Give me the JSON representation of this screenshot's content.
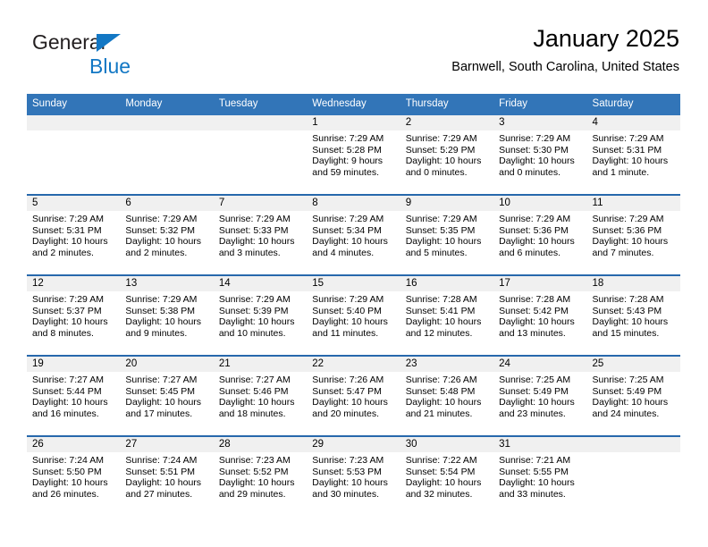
{
  "brand": {
    "line1": "General",
    "line2": "Blue",
    "accent_color": "#1277c4"
  },
  "header": {
    "title": "January 2025",
    "location": "Barnwell, South Carolina, United States"
  },
  "theme": {
    "header_bg": "#3275b8",
    "row_divider": "#2768ac",
    "daynum_band_bg": "#f0f0f0",
    "page_bg": "#ffffff"
  },
  "weekday_headers": [
    "Sunday",
    "Monday",
    "Tuesday",
    "Wednesday",
    "Thursday",
    "Friday",
    "Saturday"
  ],
  "calendar": {
    "weeks": [
      [
        {
          "day": "",
          "blank": true,
          "sunrise": "",
          "sunset": "",
          "daylight1": "",
          "daylight2": ""
        },
        {
          "day": "",
          "blank": true,
          "sunrise": "",
          "sunset": "",
          "daylight1": "",
          "daylight2": ""
        },
        {
          "day": "",
          "blank": true,
          "sunrise": "",
          "sunset": "",
          "daylight1": "",
          "daylight2": ""
        },
        {
          "day": "1",
          "blank": false,
          "sunrise": "Sunrise: 7:29 AM",
          "sunset": "Sunset: 5:28 PM",
          "daylight1": "Daylight: 9 hours",
          "daylight2": "and 59 minutes."
        },
        {
          "day": "2",
          "blank": false,
          "sunrise": "Sunrise: 7:29 AM",
          "sunset": "Sunset: 5:29 PM",
          "daylight1": "Daylight: 10 hours",
          "daylight2": "and 0 minutes."
        },
        {
          "day": "3",
          "blank": false,
          "sunrise": "Sunrise: 7:29 AM",
          "sunset": "Sunset: 5:30 PM",
          "daylight1": "Daylight: 10 hours",
          "daylight2": "and 0 minutes."
        },
        {
          "day": "4",
          "blank": false,
          "sunrise": "Sunrise: 7:29 AM",
          "sunset": "Sunset: 5:31 PM",
          "daylight1": "Daylight: 10 hours",
          "daylight2": "and 1 minute."
        }
      ],
      [
        {
          "day": "5",
          "blank": false,
          "sunrise": "Sunrise: 7:29 AM",
          "sunset": "Sunset: 5:31 PM",
          "daylight1": "Daylight: 10 hours",
          "daylight2": "and 2 minutes."
        },
        {
          "day": "6",
          "blank": false,
          "sunrise": "Sunrise: 7:29 AM",
          "sunset": "Sunset: 5:32 PM",
          "daylight1": "Daylight: 10 hours",
          "daylight2": "and 2 minutes."
        },
        {
          "day": "7",
          "blank": false,
          "sunrise": "Sunrise: 7:29 AM",
          "sunset": "Sunset: 5:33 PM",
          "daylight1": "Daylight: 10 hours",
          "daylight2": "and 3 minutes."
        },
        {
          "day": "8",
          "blank": false,
          "sunrise": "Sunrise: 7:29 AM",
          "sunset": "Sunset: 5:34 PM",
          "daylight1": "Daylight: 10 hours",
          "daylight2": "and 4 minutes."
        },
        {
          "day": "9",
          "blank": false,
          "sunrise": "Sunrise: 7:29 AM",
          "sunset": "Sunset: 5:35 PM",
          "daylight1": "Daylight: 10 hours",
          "daylight2": "and 5 minutes."
        },
        {
          "day": "10",
          "blank": false,
          "sunrise": "Sunrise: 7:29 AM",
          "sunset": "Sunset: 5:36 PM",
          "daylight1": "Daylight: 10 hours",
          "daylight2": "and 6 minutes."
        },
        {
          "day": "11",
          "blank": false,
          "sunrise": "Sunrise: 7:29 AM",
          "sunset": "Sunset: 5:36 PM",
          "daylight1": "Daylight: 10 hours",
          "daylight2": "and 7 minutes."
        }
      ],
      [
        {
          "day": "12",
          "blank": false,
          "sunrise": "Sunrise: 7:29 AM",
          "sunset": "Sunset: 5:37 PM",
          "daylight1": "Daylight: 10 hours",
          "daylight2": "and 8 minutes."
        },
        {
          "day": "13",
          "blank": false,
          "sunrise": "Sunrise: 7:29 AM",
          "sunset": "Sunset: 5:38 PM",
          "daylight1": "Daylight: 10 hours",
          "daylight2": "and 9 minutes."
        },
        {
          "day": "14",
          "blank": false,
          "sunrise": "Sunrise: 7:29 AM",
          "sunset": "Sunset: 5:39 PM",
          "daylight1": "Daylight: 10 hours",
          "daylight2": "and 10 minutes."
        },
        {
          "day": "15",
          "blank": false,
          "sunrise": "Sunrise: 7:29 AM",
          "sunset": "Sunset: 5:40 PM",
          "daylight1": "Daylight: 10 hours",
          "daylight2": "and 11 minutes."
        },
        {
          "day": "16",
          "blank": false,
          "sunrise": "Sunrise: 7:28 AM",
          "sunset": "Sunset: 5:41 PM",
          "daylight1": "Daylight: 10 hours",
          "daylight2": "and 12 minutes."
        },
        {
          "day": "17",
          "blank": false,
          "sunrise": "Sunrise: 7:28 AM",
          "sunset": "Sunset: 5:42 PM",
          "daylight1": "Daylight: 10 hours",
          "daylight2": "and 13 minutes."
        },
        {
          "day": "18",
          "blank": false,
          "sunrise": "Sunrise: 7:28 AM",
          "sunset": "Sunset: 5:43 PM",
          "daylight1": "Daylight: 10 hours",
          "daylight2": "and 15 minutes."
        }
      ],
      [
        {
          "day": "19",
          "blank": false,
          "sunrise": "Sunrise: 7:27 AM",
          "sunset": "Sunset: 5:44 PM",
          "daylight1": "Daylight: 10 hours",
          "daylight2": "and 16 minutes."
        },
        {
          "day": "20",
          "blank": false,
          "sunrise": "Sunrise: 7:27 AM",
          "sunset": "Sunset: 5:45 PM",
          "daylight1": "Daylight: 10 hours",
          "daylight2": "and 17 minutes."
        },
        {
          "day": "21",
          "blank": false,
          "sunrise": "Sunrise: 7:27 AM",
          "sunset": "Sunset: 5:46 PM",
          "daylight1": "Daylight: 10 hours",
          "daylight2": "and 18 minutes."
        },
        {
          "day": "22",
          "blank": false,
          "sunrise": "Sunrise: 7:26 AM",
          "sunset": "Sunset: 5:47 PM",
          "daylight1": "Daylight: 10 hours",
          "daylight2": "and 20 minutes."
        },
        {
          "day": "23",
          "blank": false,
          "sunrise": "Sunrise: 7:26 AM",
          "sunset": "Sunset: 5:48 PM",
          "daylight1": "Daylight: 10 hours",
          "daylight2": "and 21 minutes."
        },
        {
          "day": "24",
          "blank": false,
          "sunrise": "Sunrise: 7:25 AM",
          "sunset": "Sunset: 5:49 PM",
          "daylight1": "Daylight: 10 hours",
          "daylight2": "and 23 minutes."
        },
        {
          "day": "25",
          "blank": false,
          "sunrise": "Sunrise: 7:25 AM",
          "sunset": "Sunset: 5:49 PM",
          "daylight1": "Daylight: 10 hours",
          "daylight2": "and 24 minutes."
        }
      ],
      [
        {
          "day": "26",
          "blank": false,
          "sunrise": "Sunrise: 7:24 AM",
          "sunset": "Sunset: 5:50 PM",
          "daylight1": "Daylight: 10 hours",
          "daylight2": "and 26 minutes."
        },
        {
          "day": "27",
          "blank": false,
          "sunrise": "Sunrise: 7:24 AM",
          "sunset": "Sunset: 5:51 PM",
          "daylight1": "Daylight: 10 hours",
          "daylight2": "and 27 minutes."
        },
        {
          "day": "28",
          "blank": false,
          "sunrise": "Sunrise: 7:23 AM",
          "sunset": "Sunset: 5:52 PM",
          "daylight1": "Daylight: 10 hours",
          "daylight2": "and 29 minutes."
        },
        {
          "day": "29",
          "blank": false,
          "sunrise": "Sunrise: 7:23 AM",
          "sunset": "Sunset: 5:53 PM",
          "daylight1": "Daylight: 10 hours",
          "daylight2": "and 30 minutes."
        },
        {
          "day": "30",
          "blank": false,
          "sunrise": "Sunrise: 7:22 AM",
          "sunset": "Sunset: 5:54 PM",
          "daylight1": "Daylight: 10 hours",
          "daylight2": "and 32 minutes."
        },
        {
          "day": "31",
          "blank": false,
          "sunrise": "Sunrise: 7:21 AM",
          "sunset": "Sunset: 5:55 PM",
          "daylight1": "Daylight: 10 hours",
          "daylight2": "and 33 minutes."
        },
        {
          "day": "",
          "blank": true,
          "sunrise": "",
          "sunset": "",
          "daylight1": "",
          "daylight2": ""
        }
      ]
    ]
  }
}
